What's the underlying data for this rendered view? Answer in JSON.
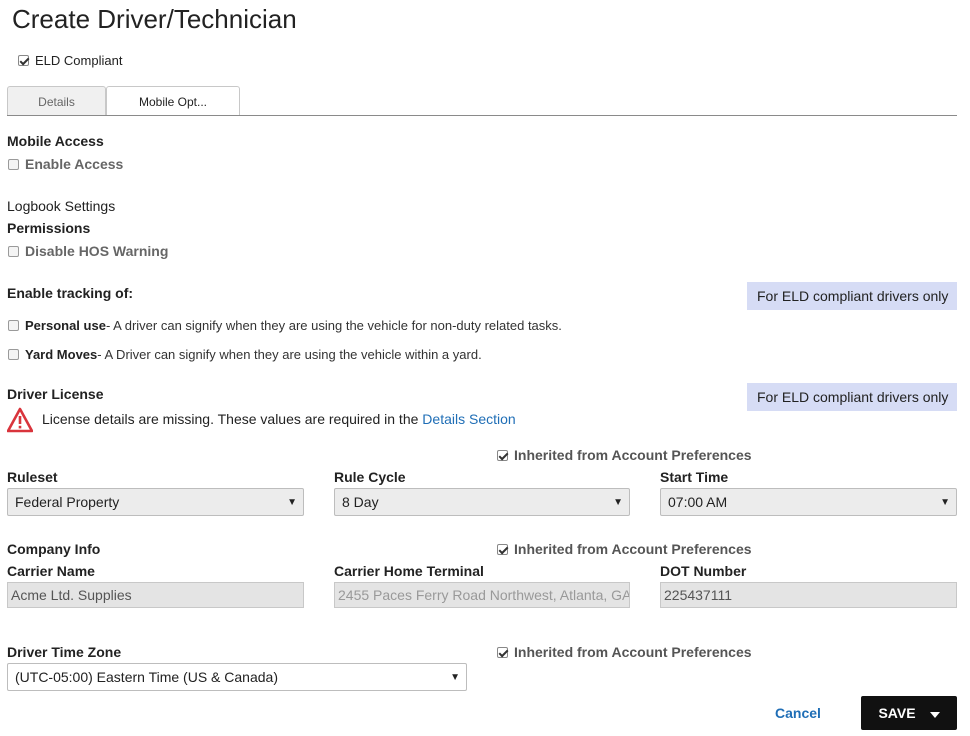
{
  "page": {
    "title": "Create Driver/Technician"
  },
  "eld": {
    "label": "ELD Compliant",
    "checked": true
  },
  "tabs": [
    {
      "label": "Details",
      "active": false
    },
    {
      "label": "Mobile Opt...",
      "active": true
    }
  ],
  "mobile_access": {
    "heading": "Mobile Access",
    "enable_access_label": "Enable Access",
    "checked": false
  },
  "logbook": {
    "heading": "Logbook Settings",
    "permissions_heading": "Permissions",
    "disable_hos_label": "Disable HOS Warning",
    "checked": false
  },
  "tracking": {
    "heading": "Enable tracking of:",
    "badge": "For ELD compliant drivers only",
    "personal_use": {
      "label": "Personal use",
      "description": " - A driver can signify when they are using the vehicle for non-duty related tasks.",
      "checked": false
    },
    "yard_moves": {
      "label": "Yard Moves",
      "description": " - A Driver can signify when they are using the vehicle within a yard.",
      "checked": false
    }
  },
  "license": {
    "heading": "Driver License",
    "badge": "For ELD compliant drivers only",
    "warning_text": "License details are missing. These values are required in the ",
    "warning_link": "Details Section"
  },
  "rules": {
    "inherited_label": "Inherited from Account Preferences",
    "ruleset_label": "Ruleset",
    "ruleset_value": "Federal Property",
    "rule_cycle_label": "Rule Cycle",
    "rule_cycle_value": "8 Day",
    "start_time_label": "Start Time",
    "start_time_value": "07:00 AM"
  },
  "company": {
    "heading": "Company Info",
    "inherited_label": "Inherited from Account Preferences",
    "carrier_name_label": "Carrier Name",
    "carrier_name_value": "Acme Ltd. Supplies",
    "home_terminal_label": "Carrier Home Terminal",
    "home_terminal_value": "2455 Paces Ferry Road Northwest, Atlanta, GA",
    "dot_label": "DOT Number",
    "dot_value": "225437111"
  },
  "timezone": {
    "label": "Driver Time Zone",
    "inherited_label": "Inherited from Account Preferences",
    "value": "(UTC-05:00) Eastern Time (US & Canada)"
  },
  "footer": {
    "cancel_label": "Cancel",
    "save_label": "SAVE"
  }
}
